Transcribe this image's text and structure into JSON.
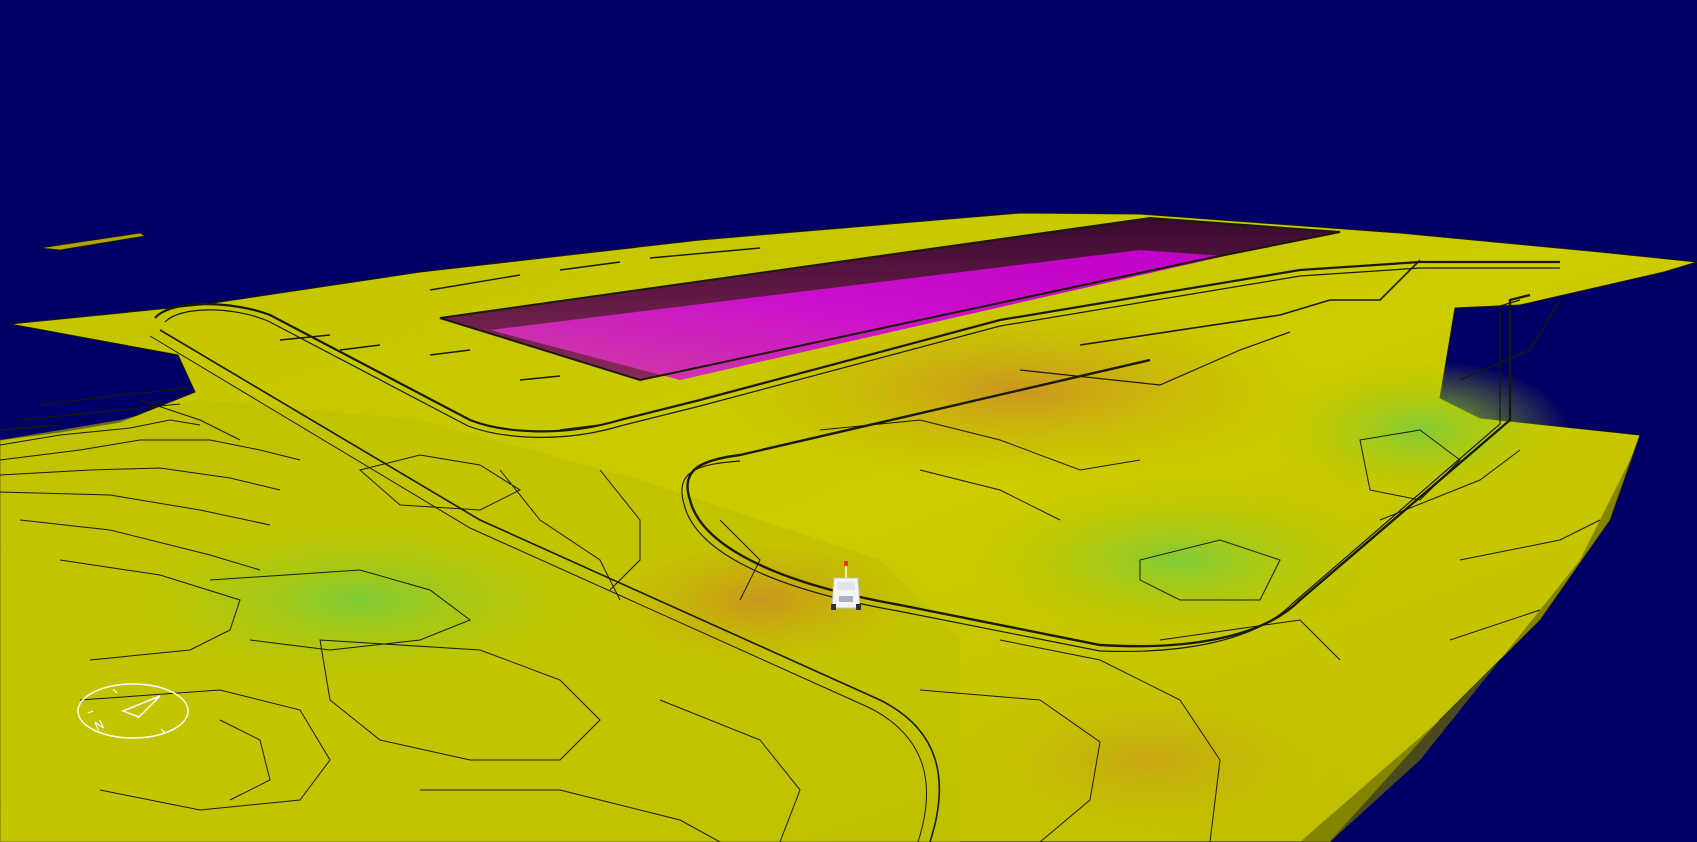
{
  "viewport": {
    "background_color": "#000066",
    "terrain_colors": {
      "yellow": "#c8c800",
      "lime": "#a8c80a",
      "green": "#8cc828",
      "olive": "#b4ae00",
      "orange": "#c89c1e",
      "pit_magenta": "#cc00cc",
      "pit_wall": "#7a0a6a",
      "contour_line": "#1a1a00"
    },
    "objects": [
      {
        "name": "open-pit",
        "color": "#cc00cc"
      },
      {
        "name": "haul-truck",
        "color": "#ffffff"
      },
      {
        "name": "compass-icon",
        "color": "#ffffff"
      }
    ],
    "compass_letter": "N"
  }
}
